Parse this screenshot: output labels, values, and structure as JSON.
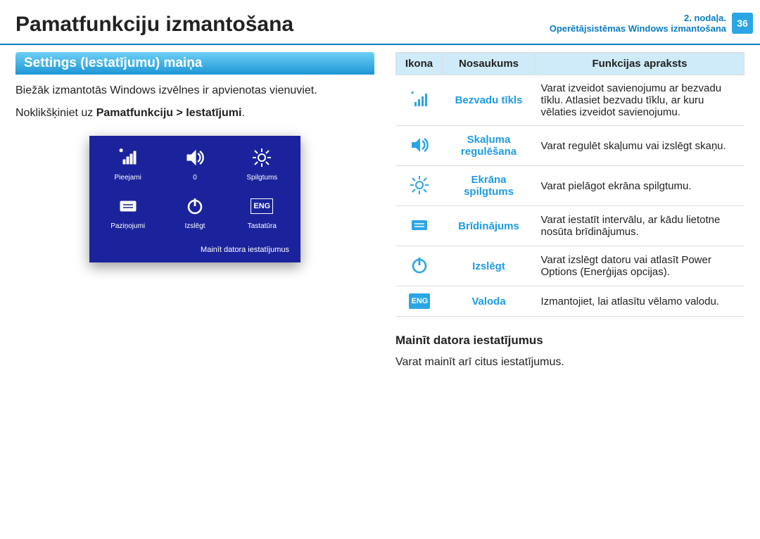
{
  "header": {
    "title": "Pamatfunkciju izmantošana",
    "chapter_line1": "2. nodaļa.",
    "chapter_line2": "Operētājsistēmas Windows izmantošana",
    "page_number": "36"
  },
  "section": {
    "heading": "Settings (Iestatījumu) maiņa",
    "para1": "Biežāk izmantotās Windows izvēlnes ir apvienotas vienuviet.",
    "para2_prefix": "Noklikšķiniet uz ",
    "para2_bold": "Pamatfunkciju > Iestatījumi",
    "para2_suffix": "."
  },
  "charms": {
    "items": [
      {
        "label": "Pieejami"
      },
      {
        "label": "0"
      },
      {
        "label": "Spilgtums"
      },
      {
        "label": "Paziņojumi"
      },
      {
        "label": "Izslēgt"
      },
      {
        "label": "Tastatūra"
      }
    ],
    "eng": "ENG",
    "footer": "Mainīt datora iestatījumus"
  },
  "table": {
    "headers": {
      "icon": "Ikona",
      "name": "Nosaukums",
      "desc": "Funkcijas apraksts"
    },
    "rows": [
      {
        "name": "Bezvadu tīkls",
        "desc": "Varat izveidot savienojumu ar bezvadu tīklu. Atlasiet bezvadu tīklu, ar kuru vēlaties izveidot savienojumu."
      },
      {
        "name": "Skaļuma regulēšana",
        "desc": "Varat regulēt skaļumu vai izslēgt skaņu."
      },
      {
        "name": "Ekrāna spilgtums",
        "desc": "Varat pielāgot ekrāna spilgtumu."
      },
      {
        "name": "Brīdinājums",
        "desc": "Varat iestatīt intervālu, ar kādu lietotne nosūta brīdinājumus."
      },
      {
        "name": "Izslēgt",
        "desc": "Varat izslēgt datoru vai atlasīt Power Options (Enerģijas opcijas)."
      },
      {
        "name": "Valoda",
        "desc": "Izmantojiet, lai atlasītu vēlamo valodu."
      }
    ],
    "eng": "ENG"
  },
  "bottom": {
    "heading": "Mainīt datora iestatījumus",
    "para": "Varat mainīt arī citus iestatījumus."
  }
}
